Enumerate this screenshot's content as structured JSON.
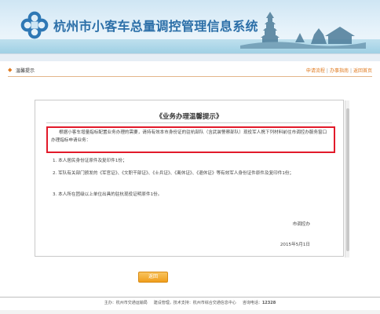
{
  "header": {
    "title": "杭州市小客车总量调控管理信息系统",
    "logo_icon": "knot-logo-icon",
    "skyline_icon": "pagoda-skyline-icon",
    "brand_color": "#2c6fa8"
  },
  "nav": {
    "section_icon": "diamond-bullet-icon",
    "section_title": "温馨提示",
    "links": [
      "申请流程",
      "办事指南",
      "返回首页"
    ],
    "separator": "|",
    "accent_color": "#e07a1f"
  },
  "notice": {
    "title": "《业务办理温馨提示》",
    "paragraph": "根据小客车增量指标配置业务办理的需要，请持有效本市身份证的驻杭部队（含武装警察部队）现役军人携下列材料前往市调控办服务窗口办理指标申请业务：",
    "items": [
      "1. 本人居民身份证原件及复印件1份；",
      "2. 军队有关部门颁发的《军官证》、《文职干部证》、《士兵证》、《离休证》、《退休证》等有效军人身份证件原件及复印件1份；",
      "3. 本人所在团级以上单位出具的驻杭现役证明原件1份。"
    ],
    "signature": "市调控办",
    "date": "2015年5月1日",
    "highlight_color": "#e21a2a"
  },
  "back_button": {
    "label": "返回"
  },
  "footer": {
    "host_label": "主办：",
    "host": "杭州市交通运输局",
    "tech_label": "建设管理，技术支持：",
    "tech": "杭州市综合交通信息中心",
    "phone_label": "咨询电话：",
    "phone": "12328"
  }
}
